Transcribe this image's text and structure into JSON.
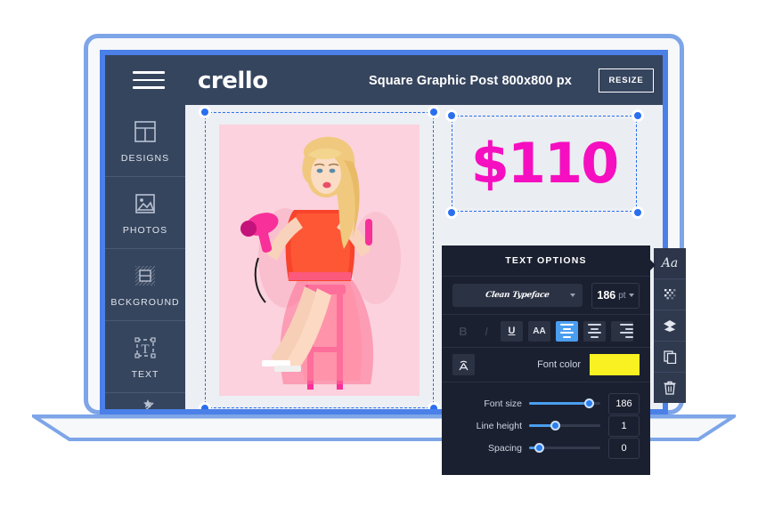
{
  "mockup": {
    "device": "laptop",
    "frame_color": "#7da5e8",
    "bezel_color": "#4a80e8"
  },
  "header": {
    "hamburger_icon": "hamburger-menu-icon",
    "brand": "crello",
    "document_title": "Square Graphic Post 800x800 px",
    "resize_label": "RESIZE",
    "background_color": "#36455e"
  },
  "sidebar": {
    "items": [
      {
        "label": "DESIGNS",
        "icon": "layout-grid-icon"
      },
      {
        "label": "PHOTOS",
        "icon": "image-photo-icon"
      },
      {
        "label": "BCKGROUND",
        "icon": "background-pattern-icon"
      },
      {
        "label": "TEXT",
        "icon": "text-box-icon"
      },
      {
        "label": "",
        "icon": "scissors-icon"
      }
    ]
  },
  "canvas": {
    "photo_element": {
      "name": "woman-with-pink-hairdryer-photo",
      "selected": true
    },
    "text_element": {
      "value": "$110",
      "color": "#f50fc0",
      "selected": true
    }
  },
  "text_options": {
    "title": "TEXT OPTIONS",
    "font_family": "Clean Typeface",
    "font_size_display": "186",
    "font_size_unit": "pt",
    "format_buttons": [
      {
        "label": "B",
        "name": "bold-button",
        "state": "disabled"
      },
      {
        "label": "I",
        "name": "italic-button",
        "state": "disabled"
      },
      {
        "label": "U",
        "name": "underline-button",
        "state": "normal"
      },
      {
        "label": "AA",
        "name": "uppercase-button",
        "state": "normal"
      }
    ],
    "alignment": [
      {
        "name": "align-left-button",
        "active": true
      },
      {
        "name": "align-center-button",
        "active": false
      },
      {
        "name": "align-right-button",
        "active": false
      }
    ],
    "letter_case_icon": "letter-spacing-icon",
    "font_color_label": "Font color",
    "font_color_value": "#faf123",
    "sliders": [
      {
        "label": "Font size",
        "value": "186",
        "fill_pct": 82
      },
      {
        "label": "Line height",
        "value": "1",
        "fill_pct": 34
      },
      {
        "label": "Spacing",
        "value": "0",
        "fill_pct": 12
      }
    ],
    "accent_color": "#4a9ef0",
    "background_color": "#1b2030"
  },
  "right_toolbar": {
    "buttons": [
      {
        "glyph": "Aa",
        "name": "text-style-icon"
      },
      {
        "glyph": "",
        "name": "transparency-icon"
      },
      {
        "glyph": "",
        "name": "layers-icon"
      },
      {
        "glyph": "",
        "name": "duplicate-icon"
      },
      {
        "glyph": "",
        "name": "trash-icon"
      }
    ]
  }
}
